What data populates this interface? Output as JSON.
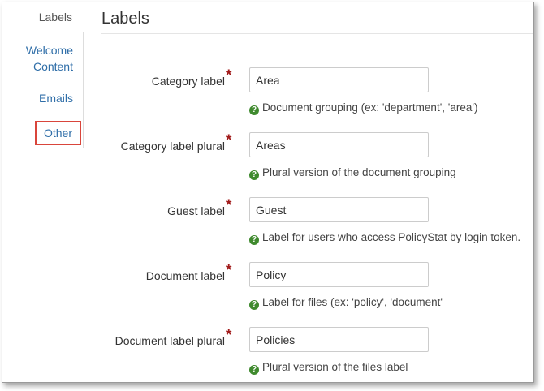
{
  "tabs": {
    "labels": "Labels",
    "welcome_line1": "Welcome",
    "welcome_line2": "Content",
    "emails": "Emails",
    "other": "Other"
  },
  "page": {
    "title": "Labels"
  },
  "required_marker": "*",
  "fields": [
    {
      "label": "Category label",
      "value": "Area",
      "help": "Document grouping (ex: 'department', 'area')"
    },
    {
      "label": "Category label plural",
      "value": "Areas",
      "help": "Plural version of the document grouping"
    },
    {
      "label": "Guest label",
      "value": "Guest",
      "help": "Label for users who access PolicyStat by login token."
    },
    {
      "label": "Document label",
      "value": "Policy",
      "help": "Label for files (ex: 'policy', 'document'"
    },
    {
      "label": "Document label plural",
      "value": "Policies",
      "help": "Plural version of the files label"
    }
  ],
  "icons": {
    "help": "question-circle-icon",
    "help_glyph": "?"
  },
  "colors": {
    "link": "#2f6ea8",
    "required": "#a11a1a",
    "help_icon": "#3f8a2e",
    "highlight": "#d9453b"
  }
}
